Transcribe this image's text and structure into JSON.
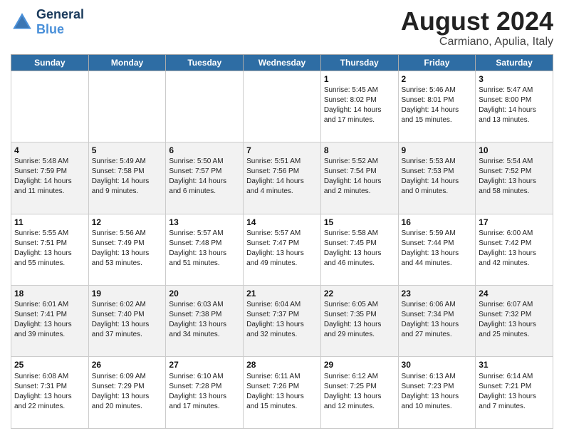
{
  "logo": {
    "line1": "General",
    "line2": "Blue"
  },
  "header": {
    "title": "August 2024",
    "subtitle": "Carmiano, Apulia, Italy"
  },
  "days_of_week": [
    "Sunday",
    "Monday",
    "Tuesday",
    "Wednesday",
    "Thursday",
    "Friday",
    "Saturday"
  ],
  "weeks": [
    [
      {
        "day": "",
        "info": ""
      },
      {
        "day": "",
        "info": ""
      },
      {
        "day": "",
        "info": ""
      },
      {
        "day": "",
        "info": ""
      },
      {
        "day": "1",
        "info": "Sunrise: 5:45 AM\nSunset: 8:02 PM\nDaylight: 14 hours\nand 17 minutes."
      },
      {
        "day": "2",
        "info": "Sunrise: 5:46 AM\nSunset: 8:01 PM\nDaylight: 14 hours\nand 15 minutes."
      },
      {
        "day": "3",
        "info": "Sunrise: 5:47 AM\nSunset: 8:00 PM\nDaylight: 14 hours\nand 13 minutes."
      }
    ],
    [
      {
        "day": "4",
        "info": "Sunrise: 5:48 AM\nSunset: 7:59 PM\nDaylight: 14 hours\nand 11 minutes."
      },
      {
        "day": "5",
        "info": "Sunrise: 5:49 AM\nSunset: 7:58 PM\nDaylight: 14 hours\nand 9 minutes."
      },
      {
        "day": "6",
        "info": "Sunrise: 5:50 AM\nSunset: 7:57 PM\nDaylight: 14 hours\nand 6 minutes."
      },
      {
        "day": "7",
        "info": "Sunrise: 5:51 AM\nSunset: 7:56 PM\nDaylight: 14 hours\nand 4 minutes."
      },
      {
        "day": "8",
        "info": "Sunrise: 5:52 AM\nSunset: 7:54 PM\nDaylight: 14 hours\nand 2 minutes."
      },
      {
        "day": "9",
        "info": "Sunrise: 5:53 AM\nSunset: 7:53 PM\nDaylight: 14 hours\nand 0 minutes."
      },
      {
        "day": "10",
        "info": "Sunrise: 5:54 AM\nSunset: 7:52 PM\nDaylight: 13 hours\nand 58 minutes."
      }
    ],
    [
      {
        "day": "11",
        "info": "Sunrise: 5:55 AM\nSunset: 7:51 PM\nDaylight: 13 hours\nand 55 minutes."
      },
      {
        "day": "12",
        "info": "Sunrise: 5:56 AM\nSunset: 7:49 PM\nDaylight: 13 hours\nand 53 minutes."
      },
      {
        "day": "13",
        "info": "Sunrise: 5:57 AM\nSunset: 7:48 PM\nDaylight: 13 hours\nand 51 minutes."
      },
      {
        "day": "14",
        "info": "Sunrise: 5:57 AM\nSunset: 7:47 PM\nDaylight: 13 hours\nand 49 minutes."
      },
      {
        "day": "15",
        "info": "Sunrise: 5:58 AM\nSunset: 7:45 PM\nDaylight: 13 hours\nand 46 minutes."
      },
      {
        "day": "16",
        "info": "Sunrise: 5:59 AM\nSunset: 7:44 PM\nDaylight: 13 hours\nand 44 minutes."
      },
      {
        "day": "17",
        "info": "Sunrise: 6:00 AM\nSunset: 7:42 PM\nDaylight: 13 hours\nand 42 minutes."
      }
    ],
    [
      {
        "day": "18",
        "info": "Sunrise: 6:01 AM\nSunset: 7:41 PM\nDaylight: 13 hours\nand 39 minutes."
      },
      {
        "day": "19",
        "info": "Sunrise: 6:02 AM\nSunset: 7:40 PM\nDaylight: 13 hours\nand 37 minutes."
      },
      {
        "day": "20",
        "info": "Sunrise: 6:03 AM\nSunset: 7:38 PM\nDaylight: 13 hours\nand 34 minutes."
      },
      {
        "day": "21",
        "info": "Sunrise: 6:04 AM\nSunset: 7:37 PM\nDaylight: 13 hours\nand 32 minutes."
      },
      {
        "day": "22",
        "info": "Sunrise: 6:05 AM\nSunset: 7:35 PM\nDaylight: 13 hours\nand 29 minutes."
      },
      {
        "day": "23",
        "info": "Sunrise: 6:06 AM\nSunset: 7:34 PM\nDaylight: 13 hours\nand 27 minutes."
      },
      {
        "day": "24",
        "info": "Sunrise: 6:07 AM\nSunset: 7:32 PM\nDaylight: 13 hours\nand 25 minutes."
      }
    ],
    [
      {
        "day": "25",
        "info": "Sunrise: 6:08 AM\nSunset: 7:31 PM\nDaylight: 13 hours\nand 22 minutes."
      },
      {
        "day": "26",
        "info": "Sunrise: 6:09 AM\nSunset: 7:29 PM\nDaylight: 13 hours\nand 20 minutes."
      },
      {
        "day": "27",
        "info": "Sunrise: 6:10 AM\nSunset: 7:28 PM\nDaylight: 13 hours\nand 17 minutes."
      },
      {
        "day": "28",
        "info": "Sunrise: 6:11 AM\nSunset: 7:26 PM\nDaylight: 13 hours\nand 15 minutes."
      },
      {
        "day": "29",
        "info": "Sunrise: 6:12 AM\nSunset: 7:25 PM\nDaylight: 13 hours\nand 12 minutes."
      },
      {
        "day": "30",
        "info": "Sunrise: 6:13 AM\nSunset: 7:23 PM\nDaylight: 13 hours\nand 10 minutes."
      },
      {
        "day": "31",
        "info": "Sunrise: 6:14 AM\nSunset: 7:21 PM\nDaylight: 13 hours\nand 7 minutes."
      }
    ]
  ]
}
